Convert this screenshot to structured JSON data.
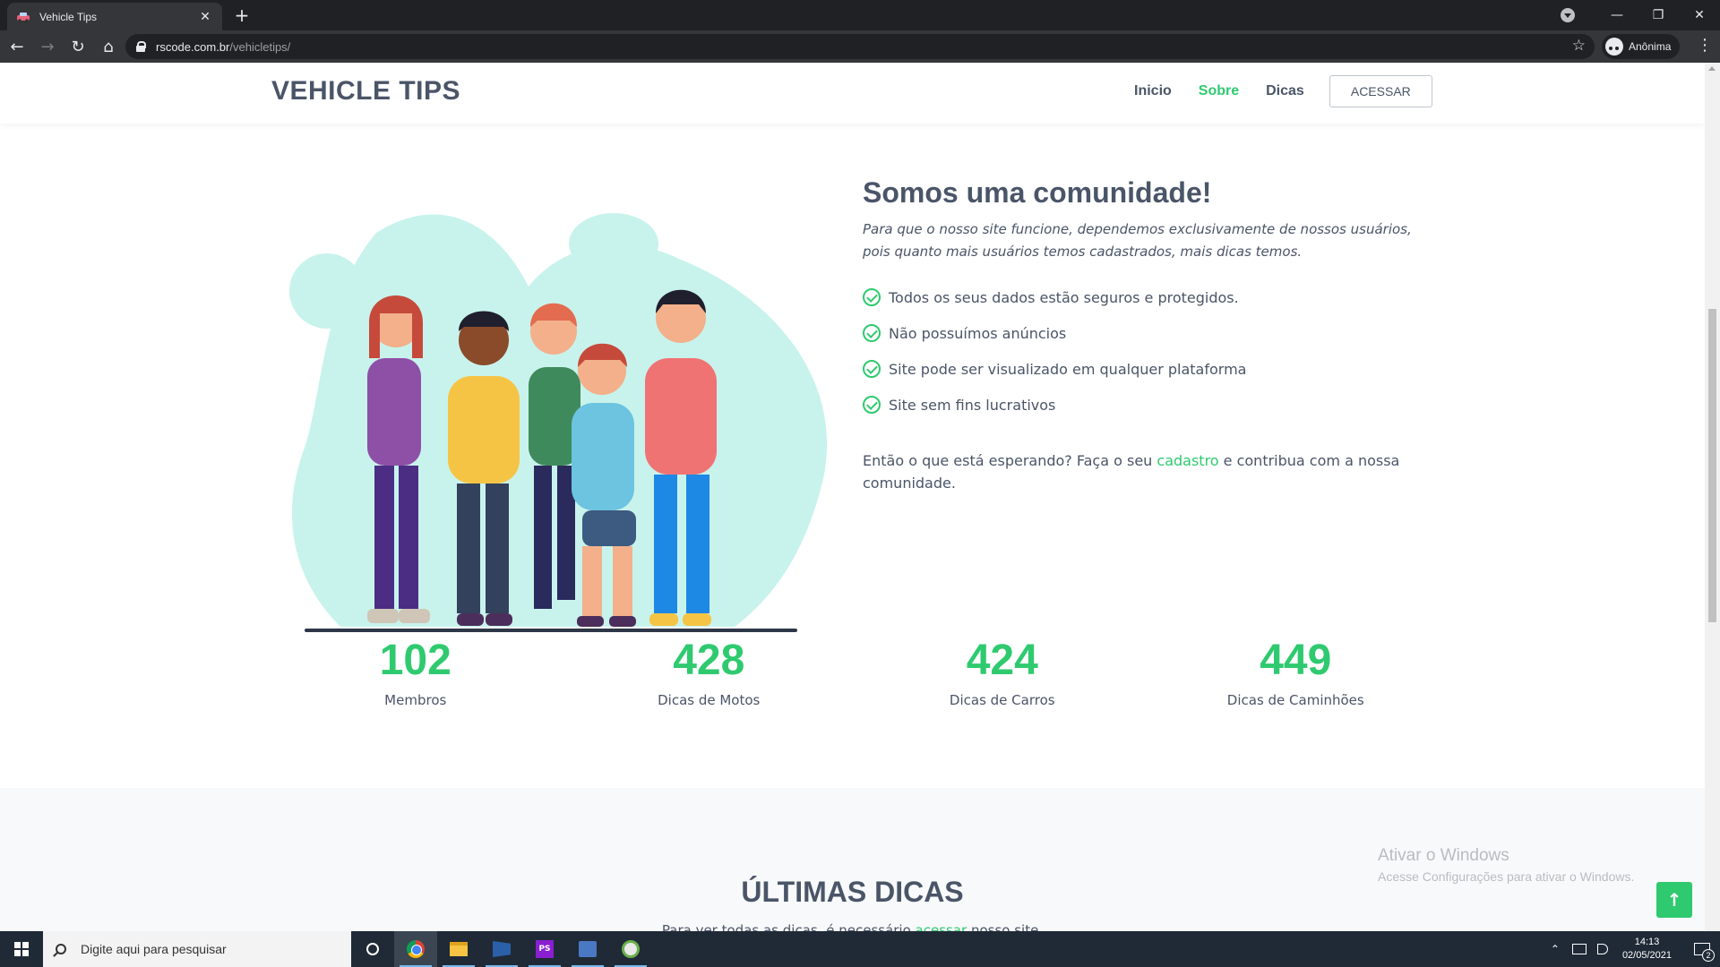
{
  "browser": {
    "tab_title": "Vehicle Tips",
    "tab_close": "✕",
    "new_tab": "+",
    "url_host": "rscode.com.br",
    "url_path": "/vehicletips/",
    "profile_label": "Anônima",
    "window_controls": {
      "minimize": "—",
      "restore": "❐",
      "close": "✕"
    }
  },
  "site": {
    "brand": "VEHICLE TIPS",
    "nav": [
      {
        "label": "Inicio",
        "active": false
      },
      {
        "label": "Sobre",
        "active": true
      },
      {
        "label": "Dicas",
        "active": false
      }
    ],
    "access_button": "ACESSAR",
    "accent_color": "#2fca6f",
    "text_color": "#4a5568"
  },
  "about": {
    "title": "Somos uma comunidade!",
    "lead": "Para que o nosso site funcione, dependemos exclusivamente de nossos usuários, pois quanto mais usuários temos cadastrados, mais dicas temos.",
    "features": [
      "Todos os seus dados estão seguros e protegidos.",
      "Não possuímos anúncios",
      "Site pode ser visualizado em qualquer plataforma",
      "Site sem fins lucrativos"
    ],
    "cta_before": "Então o que está esperando? Faça o seu ",
    "cta_link": "cadastro",
    "cta_after": " e contribua com a nossa comunidade."
  },
  "stats": [
    {
      "value": "102",
      "label": "Membros"
    },
    {
      "value": "428",
      "label": "Dicas de Motos"
    },
    {
      "value": "424",
      "label": "Dicas de Carros"
    },
    {
      "value": "449",
      "label": "Dicas de Caminhões"
    }
  ],
  "tips": {
    "title": "ÚLTIMAS DICAS",
    "subtitle_before": "Para ver todas as dicas, é necessário ",
    "subtitle_link": "acessar",
    "subtitle_after": " nosso site."
  },
  "watermark": {
    "line1": "Ativar o Windows",
    "line2": "Acesse Configurações para ativar o Windows."
  },
  "back_to_top": "↑",
  "taskbar": {
    "search_placeholder": "Digite aqui para pesquisar",
    "time": "14:13",
    "date": "02/05/2021",
    "notification_count": "2",
    "apps": [
      "chrome-icon",
      "file-explorer-icon",
      "visual-studio-icon",
      "phpstorm-icon",
      "tool-icon",
      "paint-icon"
    ]
  }
}
